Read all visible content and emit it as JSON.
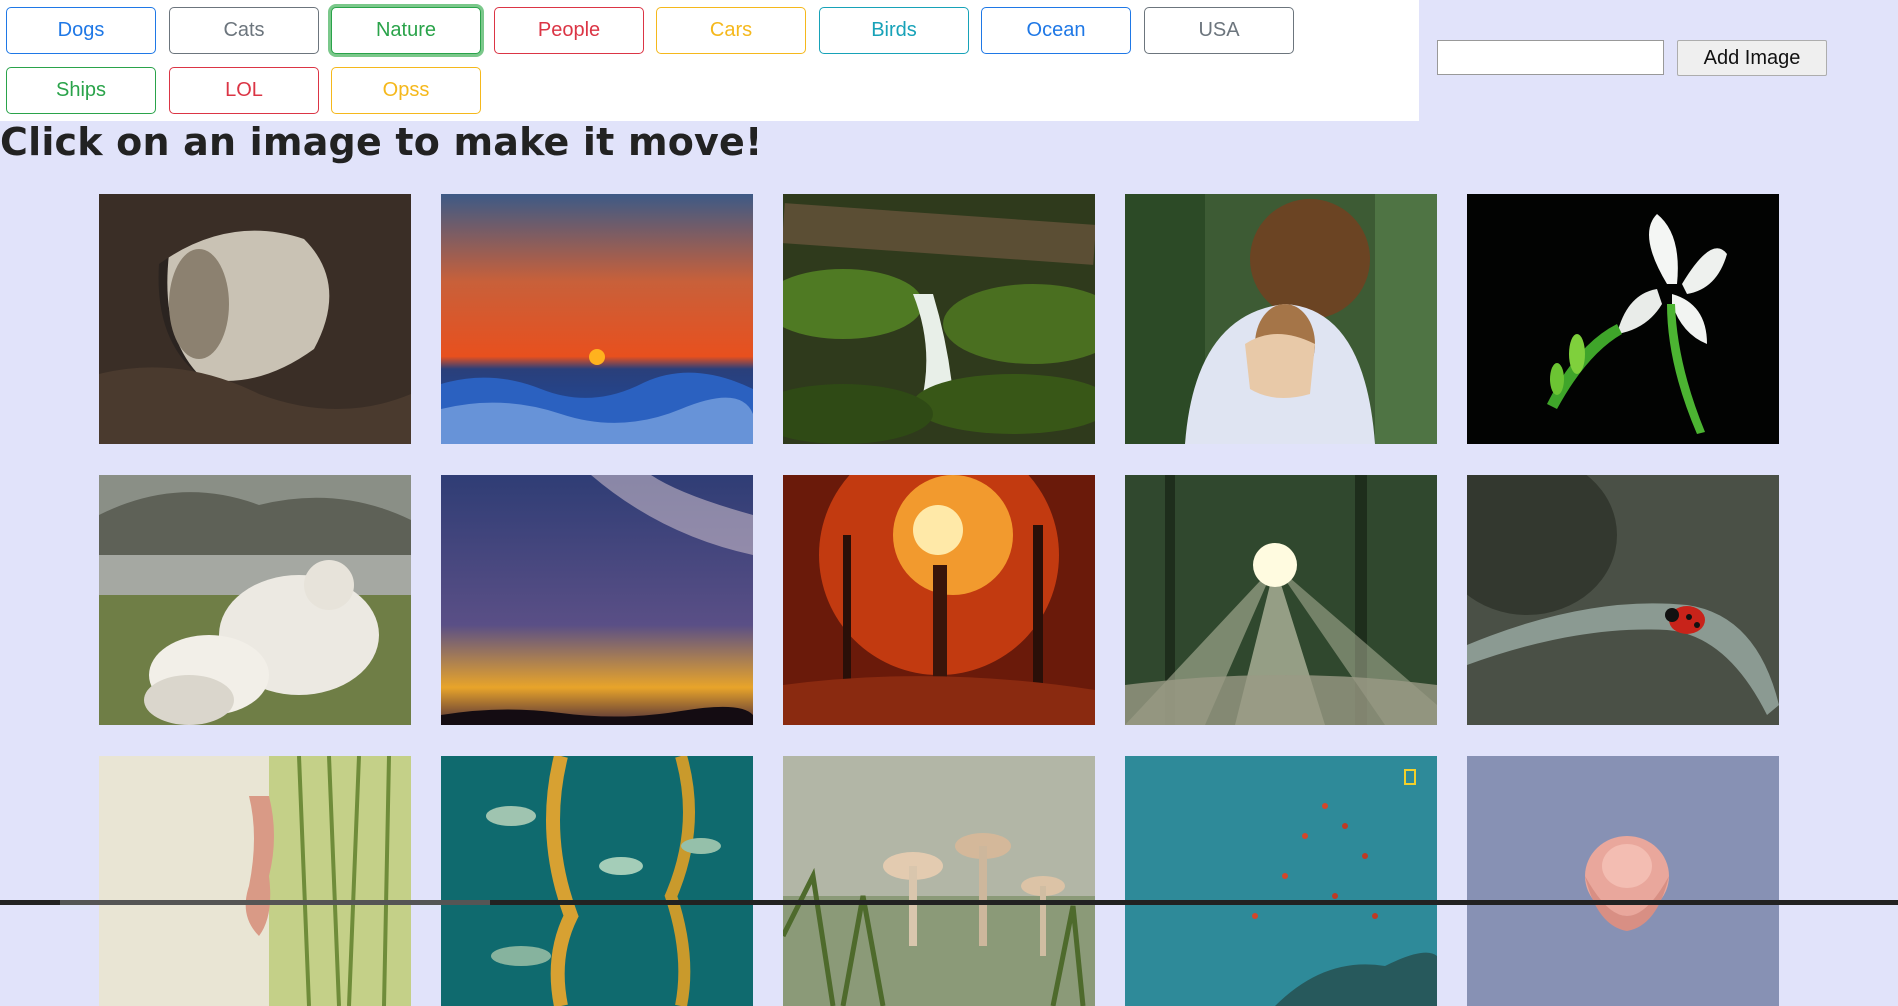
{
  "categories": [
    {
      "label": "Dogs",
      "style": "blue"
    },
    {
      "label": "Cats",
      "style": "gray"
    },
    {
      "label": "Nature",
      "style": "green"
    },
    {
      "label": "People",
      "style": "red"
    },
    {
      "label": "Cars",
      "style": "yellow"
    },
    {
      "label": "Birds",
      "style": "teal"
    },
    {
      "label": "Ocean",
      "style": "blue"
    },
    {
      "label": "USA",
      "style": "gray"
    },
    {
      "label": "Ships",
      "style": "green"
    },
    {
      "label": "LOL",
      "style": "red"
    },
    {
      "label": "Opss",
      "style": "yellow"
    }
  ],
  "active_category": "Nature",
  "add_image": {
    "input_value": "",
    "button_label": "Add Image"
  },
  "heading": "Click on an image to make it move!",
  "gallery_icons": [
    "cave-image",
    "sunset-ocean-image",
    "forest-stream-image",
    "man-with-fawn-image",
    "white-flower-image",
    "wolf-pups-image",
    "milky-way-image",
    "autumn-forest-image",
    "sunbeam-forest-image",
    "ladybug-image",
    "hand-in-grass-image",
    "aquarium-kelp-image",
    "mushrooms-image",
    "fish-reef-image",
    "pink-rose-image"
  ],
  "colors": {
    "page_background": "#e1e3fa",
    "topbar_background": "#ffffff"
  }
}
